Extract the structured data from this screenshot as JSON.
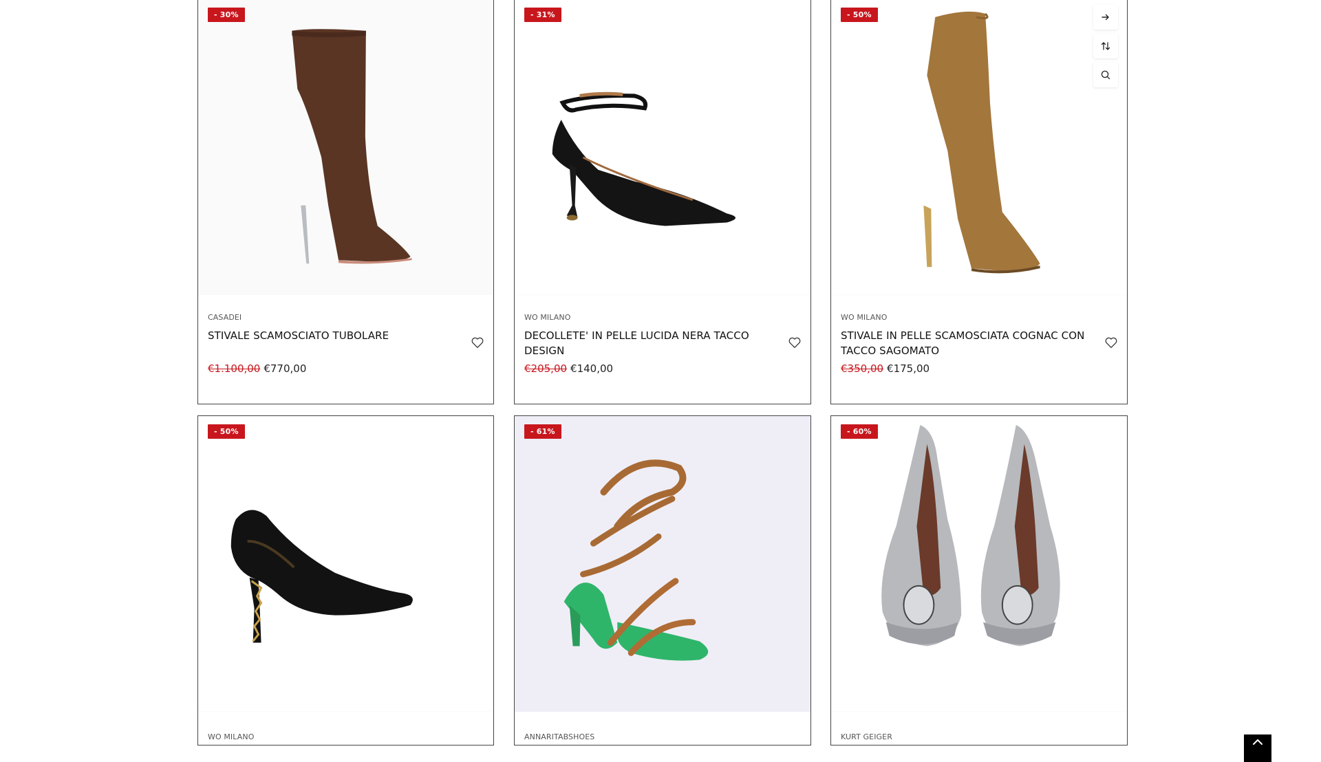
{
  "products": [
    {
      "discount": "- 30%",
      "brand": "CASADEI",
      "name": "STIVALE SCAMOSCIATO TUBOLARE",
      "price_old": "€1.100,00",
      "price_new": "€770,00",
      "image": "brown-suede-knee-boot"
    },
    {
      "discount": "- 31%",
      "brand": "WO MILANO",
      "name": "DECOLLETE' IN PELLE LUCIDA NERA TACCO DESIGN",
      "price_old": "€205,00",
      "price_new": "€140,00",
      "image": "black-patent-ankle-strap-pump"
    },
    {
      "discount": "- 50%",
      "brand": "WO MILANO",
      "name": "STIVALE IN PELLE SCAMOSCIATA COGNAC CON TACCO SAGOMATO",
      "price_old": "€350,00",
      "price_new": "€175,00",
      "image": "cognac-suede-boot"
    },
    {
      "discount": "- 50%",
      "brand": "WO MILANO",
      "image": "black-leather-pump-sculpted-heel"
    },
    {
      "discount": "- 61%",
      "brand": "ANNARITABSHOES",
      "image": "green-tan-lace-up-sandal"
    },
    {
      "discount": "- 60%",
      "brand": "KURT GEIGER",
      "image": "silver-peep-toe-pumps"
    }
  ],
  "actions": {
    "icons": [
      "arrow-right-icon",
      "compare-arrows-icon",
      "quick-view-search-icon"
    ]
  },
  "colors": {
    "sale_red": "#c8161d",
    "border": "#444444",
    "text": "#111111"
  }
}
